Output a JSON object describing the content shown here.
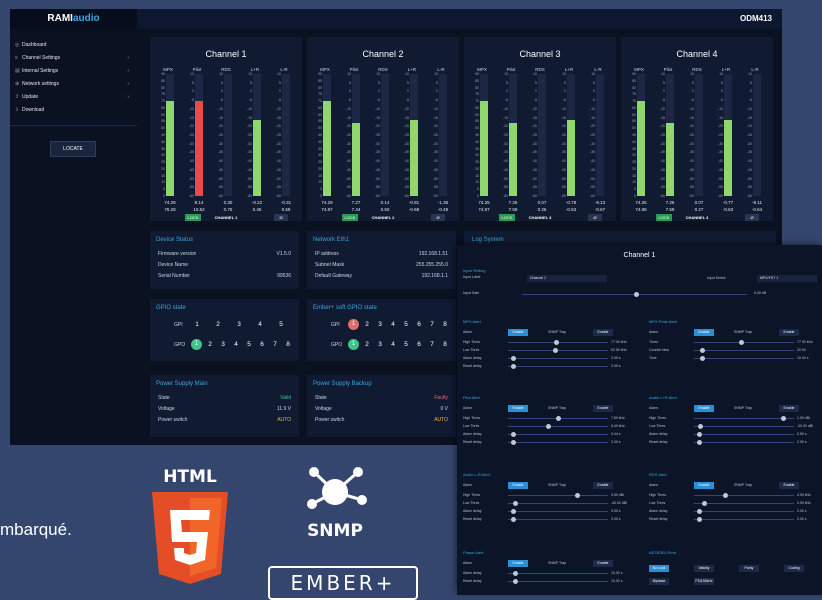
{
  "background_text": "mbarqué.",
  "logos": {
    "html5": "HTML",
    "snmp": "SNMP",
    "ember": "EMBER+"
  },
  "app": {
    "brand_main": "RAMI",
    "brand_accent": "audio",
    "device": "ODM413"
  },
  "sidebar": {
    "items": [
      {
        "label": "Dashboard",
        "icon": "dashboard-icon"
      },
      {
        "label": "Channel Settings",
        "icon": "list-icon"
      },
      {
        "label": "Internal Settings",
        "icon": "settings-icon"
      },
      {
        "label": "Network settings",
        "icon": "network-icon"
      },
      {
        "label": "Update",
        "icon": "upload-icon"
      },
      {
        "label": "Download",
        "icon": "download-icon"
      }
    ],
    "locate": "LOCATE"
  },
  "meter_labels": [
    "MPX",
    "Pilot",
    "RDS",
    "L+R",
    "L-R"
  ],
  "mpx_scale": [
    "90",
    "85",
    "80",
    "75",
    "70",
    "65",
    "60",
    "55",
    "50",
    "45",
    "40",
    "35",
    "30",
    "25",
    "20",
    "15",
    "10",
    "5",
    "0"
  ],
  "lr_scale": [
    "10",
    "5",
    "0",
    "-5",
    "-10",
    "-15",
    "-20",
    "-25",
    "-30",
    "-35",
    "-40",
    "-45",
    "-50",
    "-55",
    "-60"
  ],
  "channels": [
    {
      "title": "Channel 1",
      "name": "CHANNEL 1",
      "lock": "LOCK",
      "phase": "Ø",
      "row1": [
        "74.29",
        "8.14",
        "0.30",
        "-0.22",
        "-0.31"
      ],
      "row2": [
        "76.29",
        "10.52",
        "0.75",
        "0.45",
        "0.59"
      ],
      "levels": [
        0.78,
        0.78,
        0.0,
        0.62,
        0.0
      ],
      "pilot_alarm": true
    },
    {
      "title": "Channel 2",
      "name": "CHANNEL 2",
      "lock": "LOCK",
      "phase": "Ø",
      "row1": [
        "74.29",
        "7.27",
        "0.14",
        "-0.81",
        "-1.36"
      ],
      "row2": [
        "74.87",
        "7.44",
        "0.50",
        "-0.68",
        "-0.49"
      ],
      "levels": [
        0.78,
        0.6,
        0.0,
        0.62,
        0.0
      ],
      "pilot_alarm": false
    },
    {
      "title": "Channel 3",
      "name": "CHANNEL 3",
      "lock": "LOCK",
      "phase": "Ø",
      "row1": [
        "74.25",
        "7.25",
        "0.07",
        "-0.78",
        "-9.13"
      ],
      "row2": [
        "74.97",
        "7.59",
        "0.26",
        "-0.63",
        "-0.67"
      ],
      "levels": [
        0.78,
        0.6,
        0.0,
        0.62,
        0.0
      ],
      "pilot_alarm": false
    },
    {
      "title": "Channel 4",
      "name": "CHANNEL 4",
      "lock": "LOCK",
      "phase": "Ø",
      "row1": [
        "74.25",
        "7.26",
        "0.07",
        "-0.77",
        "-9.11"
      ],
      "row2": [
        "74.98",
        "7.59",
        "0.27",
        "-0.63",
        "-0.64"
      ],
      "levels": [
        0.78,
        0.6,
        0.0,
        0.62,
        0.0
      ],
      "pilot_alarm": false
    }
  ],
  "device_status": {
    "title": "Device Status",
    "rows": [
      [
        "Firmware version",
        "V1.5.0"
      ],
      [
        "Device Name",
        ""
      ],
      [
        "Serial Number",
        "99536"
      ]
    ]
  },
  "network": {
    "title": "Network Eth1",
    "rows": [
      [
        "IP address",
        "192.168.1.51"
      ],
      [
        "Subnet Mask",
        "255.255.255.0"
      ],
      [
        "Default Gateway",
        "192.168.1.1"
      ]
    ]
  },
  "log": {
    "title": "Log System"
  },
  "gpio": {
    "title": "GPIO state",
    "gpi_label": "GPI",
    "gpo_label": "GPO",
    "gpi": [
      "1",
      "2",
      "3",
      "4",
      "5"
    ],
    "gpo": [
      "1",
      "2",
      "3",
      "4",
      "5",
      "6",
      "7",
      "8"
    ]
  },
  "ember_gpio": {
    "title": "Ember+ soft GPIO state",
    "gpi_label": "GPI",
    "gpo_label": "GPO",
    "gpi": [
      "1",
      "2",
      "3",
      "4",
      "5",
      "6",
      "7",
      "8"
    ],
    "gpo": [
      "1",
      "2",
      "3",
      "4",
      "5",
      "6",
      "7",
      "8"
    ]
  },
  "psu_main": {
    "title": "Power Supply Main",
    "rows": [
      [
        "State",
        "Valid"
      ],
      [
        "Voltage",
        "11.9 V"
      ],
      [
        "Power switch",
        "AUTO"
      ]
    ]
  },
  "psu_backup": {
    "title": "Power Supply Backup",
    "rows": [
      [
        "State",
        "Faulty"
      ],
      [
        "Voltage",
        "0 V"
      ],
      [
        "Power switch",
        "AUTO"
      ]
    ]
  },
  "colors": {
    "valid": "#3fc58a",
    "faulty": "#e06b6b",
    "auto": "#e8b93a",
    "green_bar": "#8fd66d",
    "red_bar": "#e74b4b",
    "lock": "#2b9a55"
  },
  "detail": {
    "title": "Channel 1",
    "input_setting": "Input Setting",
    "input_label": "Input Label",
    "input_value": "Channel 1",
    "input_select": "Input Select",
    "input_select_value": "MPX/YS7 1",
    "input_gain": "Input Gain",
    "input_gain_value": "0.00 dB",
    "mpx_alert": "MPX Alert",
    "mpx_peak": "MPX Peak Alert",
    "pilot_alert": "Pilot Alert",
    "audio_lr_alert": "Audio L+R Alert",
    "audio_lmr_alert": "Audio L-R Alert",
    "rds_alert": "RDS Alert",
    "phase_alert": "Phase Alert",
    "aes_error": "AES/EBU Error",
    "alarm": "Alarm",
    "enable": "Enable",
    "snmp_trap": "SNMP Trap",
    "high_thres": "High Thres",
    "low_thres": "Low Thres",
    "alarm_delay": "Alarm delay",
    "reset_delay": "Reset delay",
    "thres": "Thres",
    "counter_max": "Counter Max",
    "time": "Time",
    "mpx_vals": [
      "77.00 kHz",
      "62.50 kHz",
      "2.00 s",
      "2.00 s"
    ],
    "peak_vals": [
      "77.00 kHz",
      "20.00",
      "10.00 s"
    ],
    "pilot_vals": [
      "7.80 kHz",
      "6.40 kHz",
      "0.44 s",
      "2.00 s"
    ],
    "lr_vals": [
      "1.00 dBl",
      "-40.00 dBl",
      "0.50 s",
      "2.00 s"
    ],
    "lmr_vals": [
      "0.50 dBl",
      "-40.00 dBl",
      "0.50 s",
      "2.00 s"
    ],
    "rds_vals": [
      "4.90 kHz",
      "0.90 kHz",
      "2.00 s",
      "2.00 s"
    ],
    "phase_vals": [
      "10.00 s",
      "10.00 s"
    ],
    "aes_buttons": [
      "No Lock",
      "Validity",
      "Parity",
      "Coding"
    ],
    "aes_buttons2": [
      "Biphase",
      "FS/192kHz"
    ]
  }
}
